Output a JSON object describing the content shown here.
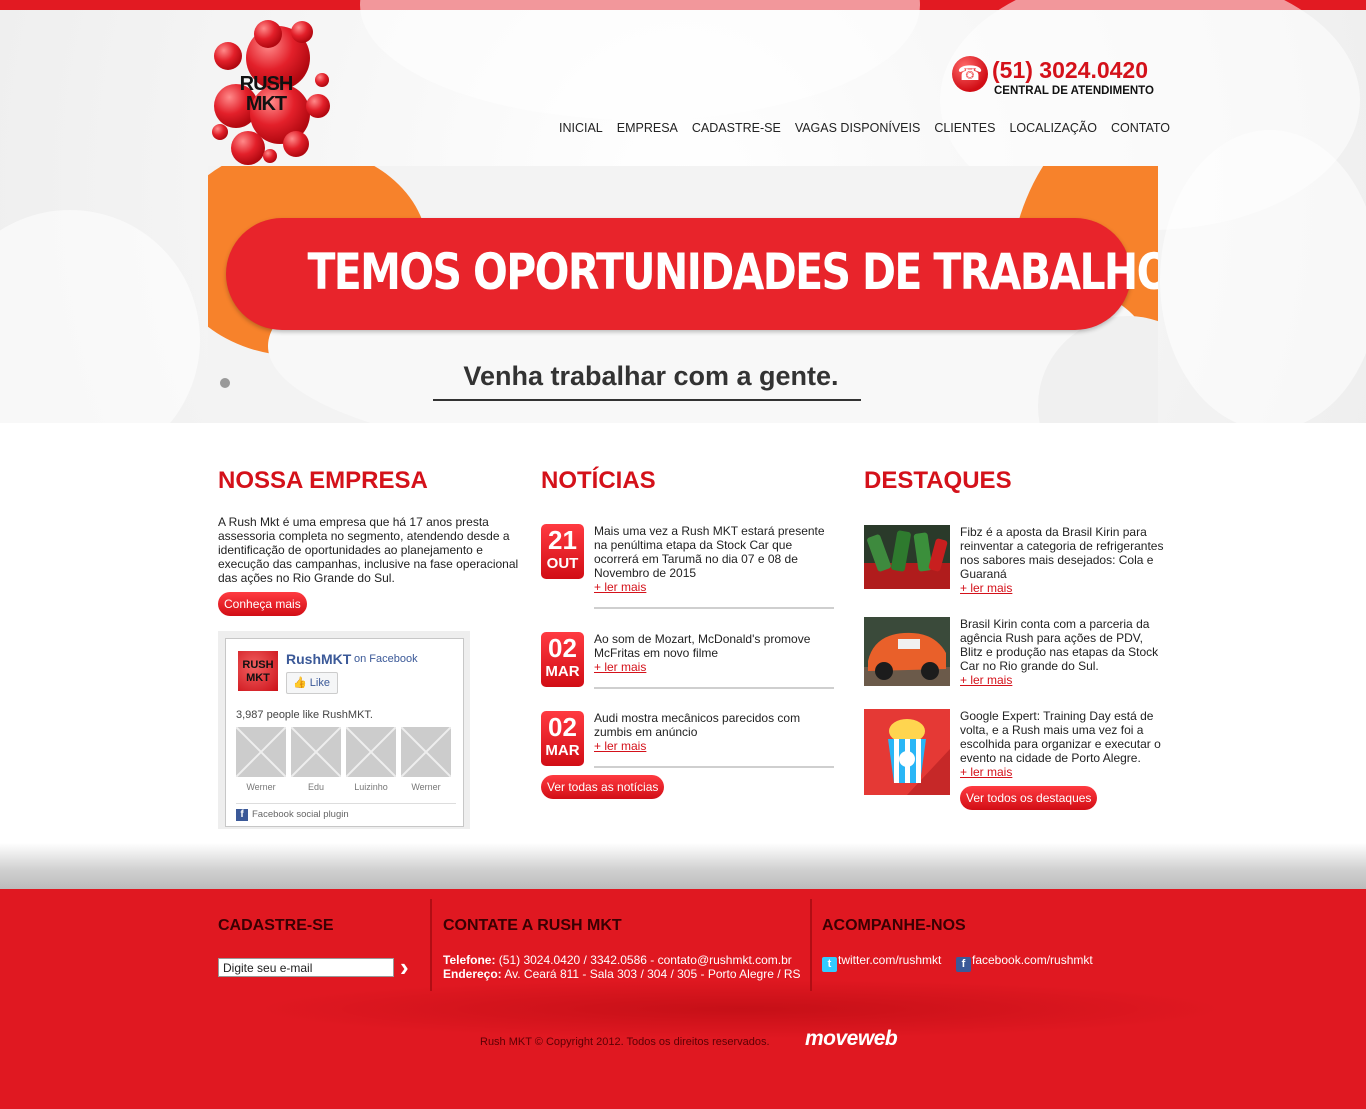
{
  "brand": {
    "logo_line1": "RUSH",
    "logo_line2": "MKT",
    "color": "#e21a22"
  },
  "contact_header": {
    "phone": "(51) 3024.0420",
    "label": "CENTRAL DE ATENDIMENTO"
  },
  "nav": [
    "INICIAL",
    "EMPRESA",
    "CADASTRE-SE",
    "VAGAS DISPONÍVEIS",
    "CLIENTES",
    "LOCALIZAÇÃO",
    "CONTATO"
  ],
  "banner": {
    "title": "TEMOS OPORTUNIDADES DE TRABALHOS",
    "subtitle": "Venha trabalhar com a gente."
  },
  "empresa": {
    "title": "NOSSA EMPRESA",
    "text": "A Rush Mkt é uma empresa que há 17 anos presta assessoria completa no segmento, atendendo desde a identificação de oportunidades ao planejamento e execução das campanhas, inclusive na fase operacional das ações no Rio Grande do Sul.",
    "button": "Conheça mais"
  },
  "facebook": {
    "page": "RushMKT",
    "on": "on Facebook",
    "like": "Like",
    "count": "3,987 people like RushMKT.",
    "faces": [
      "Werner",
      "Edu",
      "Luizinho",
      "Werner"
    ],
    "plugin": "Facebook social plugin"
  },
  "noticias": {
    "title": "NOTÍCIAS",
    "items": [
      {
        "day": "21",
        "month": "OUT",
        "text": "Mais uma vez a Rush MKT estará presente na penúltima etapa da Stock Car que ocorrerá em Tarumã no dia 07 e 08 de Novembro de 2015",
        "more": "+ ler mais"
      },
      {
        "day": "02",
        "month": "MAR",
        "text": "Ao som de Mozart, McDonald's promove McFritas em novo filme",
        "more": "+ ler mais"
      },
      {
        "day": "02",
        "month": "MAR",
        "text": "Audi mostra mecânicos parecidos com zumbis em anúncio",
        "more": "+ ler mais"
      }
    ],
    "button": "Ver todas as notícias"
  },
  "destaques": {
    "title": "DESTAQUES",
    "items": [
      {
        "text": "Fibz é a aposta da Brasil Kirin para reinventar a categoria de refrigerantes nos sabores mais desejados: Cola e Guaraná",
        "more": "+ ler mais"
      },
      {
        "text": "Brasil Kirin conta com a parceria da agência Rush para ações de PDV, Blitz e produção nas etapas da Stock Car no Rio grande do Sul.",
        "more": "+ ler mais"
      },
      {
        "text": "Google Expert: Training Day está de volta, e a Rush mais uma vez foi a escolhida para organizar e executar o evento na cidade de Porto Alegre.",
        "more": "+ ler mais"
      }
    ],
    "button": "Ver todos os destaques"
  },
  "footer": {
    "cadastre_title": "CADASTRE-SE",
    "email_placeholder": "Digite seu e-mail",
    "contate_title": "CONTATE A RUSH MKT",
    "tel_label": "Telefone:",
    "tel_value": " (51) 3024.0420 / 3342.0586 - contato@rushmkt.com.br",
    "end_label": "Endereço:",
    "end_value": " Av. Ceará 811 - Sala 303 / 304 / 305 - Porto Alegre / RS",
    "social_title": "ACOMPANHE-NOS",
    "twitter": "twitter.com/rushmkt",
    "facebook": "facebook.com/rushmkt",
    "copyright": "Rush MKT © Copyright 2012. Todos os direitos reservados.",
    "credit": "moveweb"
  }
}
